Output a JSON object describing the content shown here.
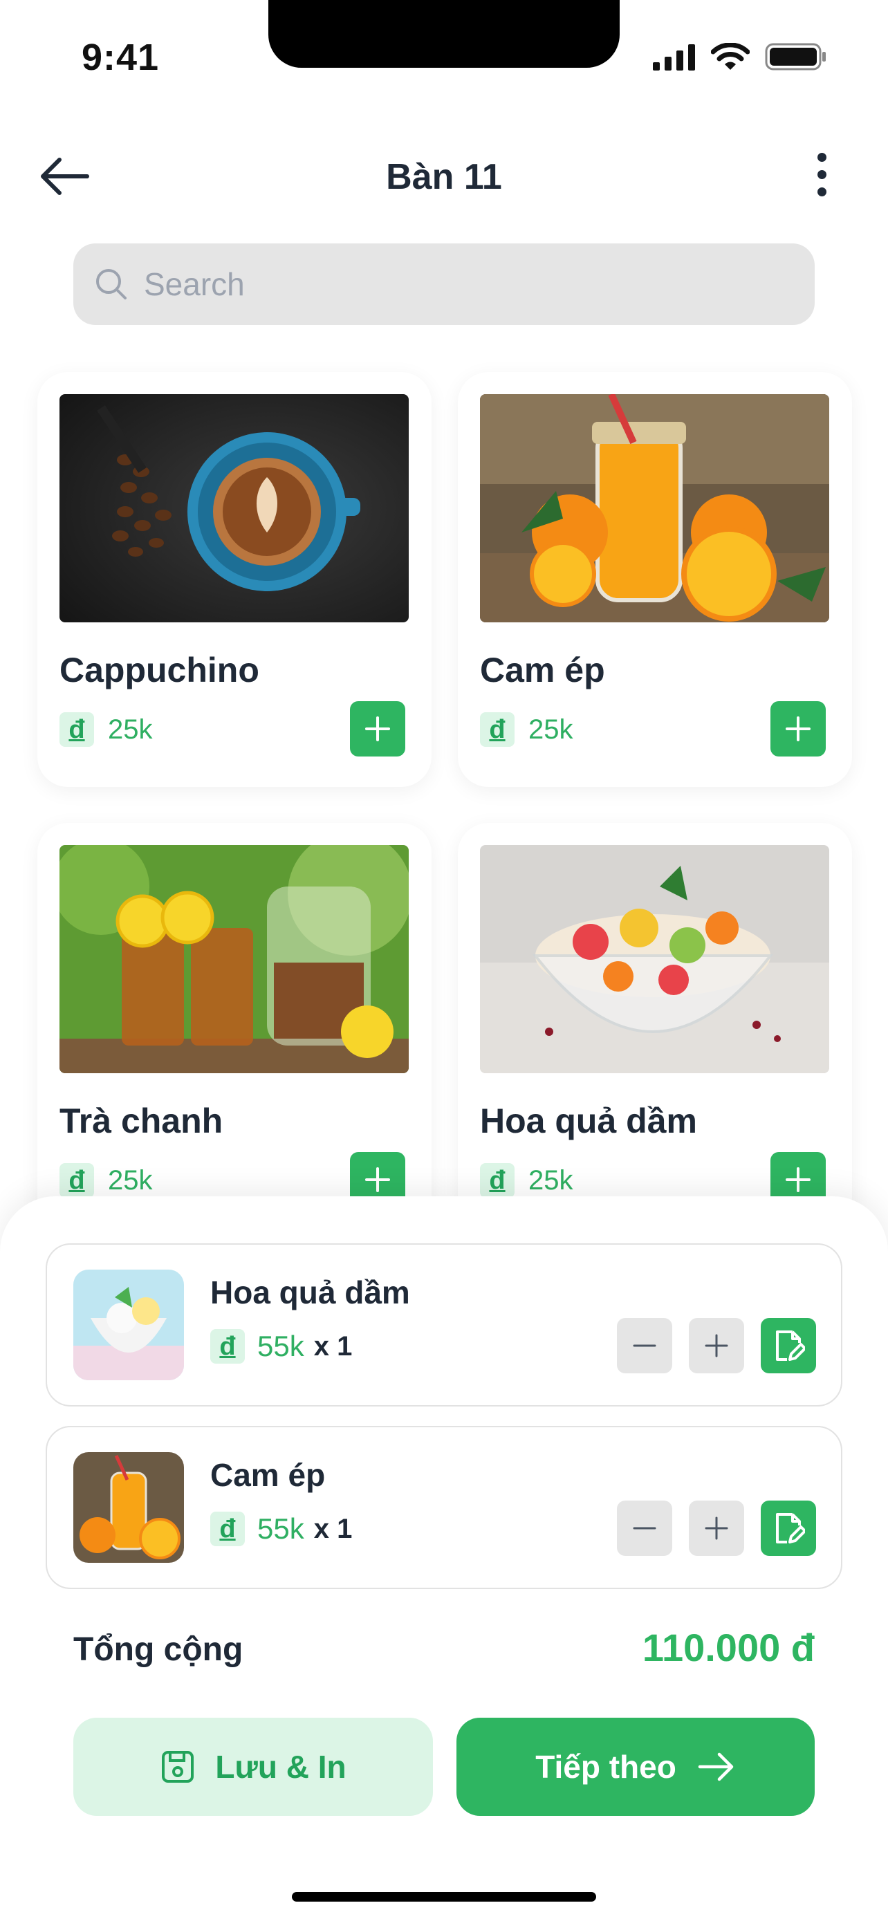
{
  "status_bar": {
    "time": "9:41"
  },
  "header": {
    "title": "Bàn 11"
  },
  "search": {
    "placeholder": "Search"
  },
  "products": [
    {
      "name": "Cappuchino",
      "currency_symbol": "đ",
      "price": "25k"
    },
    {
      "name": "Cam ép",
      "currency_symbol": "đ",
      "price": "25k"
    },
    {
      "name": "Trà chanh",
      "currency_symbol": "đ",
      "price": "25k"
    },
    {
      "name": "Hoa quả dầm",
      "currency_symbol": "đ",
      "price": "25k"
    }
  ],
  "cart": {
    "items": [
      {
        "name": "Hoa quả dầm",
        "currency_symbol": "đ",
        "price": "55k",
        "quantity": "x 1"
      },
      {
        "name": "Cam ép",
        "currency_symbol": "đ",
        "price": "55k",
        "quantity": "x 1"
      }
    ],
    "total_label": "Tổng cộng",
    "total_value": "110.000 đ"
  },
  "actions": {
    "save_label": "Lưu & In",
    "next_label": "Tiếp theo"
  },
  "colors": {
    "primary": "#2eb561",
    "primary_light": "#dcf5e6",
    "text": "#1f2937",
    "muted": "#9ca3af"
  }
}
